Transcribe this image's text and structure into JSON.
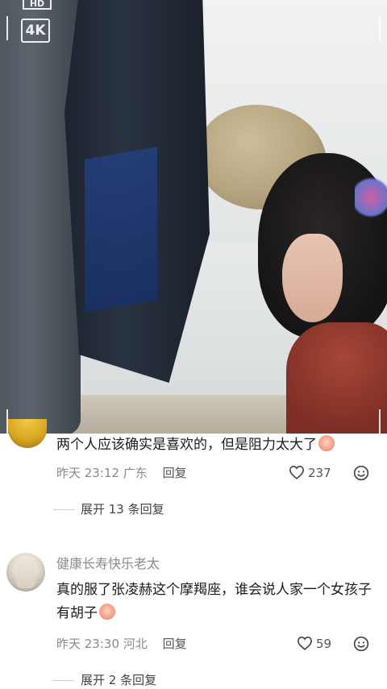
{
  "video": {
    "badge_hd": "HD",
    "badge_4k": "4K"
  },
  "comments": [
    {
      "username": "",
      "text": "两个人应该确实是喜欢的，但是阻力太大了",
      "time": "昨天 23:12",
      "location": "广东",
      "reply_label": "回复",
      "likes": "237",
      "expand_label": "展开 13 条回复"
    },
    {
      "username": "健康长寿快乐老太",
      "text": "真的服了张凌赫这个摩羯座，谁会说人家一个女孩子有胡子",
      "time": "昨天 23:30",
      "location": "河北",
      "reply_label": "回复",
      "likes": "59",
      "expand_label": "展开 2 条回复"
    }
  ],
  "icons": {
    "like": "heart-outline-icon",
    "react": "smiley-icon",
    "emoji_1": "crying-face-emoji",
    "emoji_2": "crying-face-emoji"
  },
  "colors": {
    "text": "#1b1b1b",
    "meta": "#8a8a8a",
    "reply": "#555555"
  }
}
